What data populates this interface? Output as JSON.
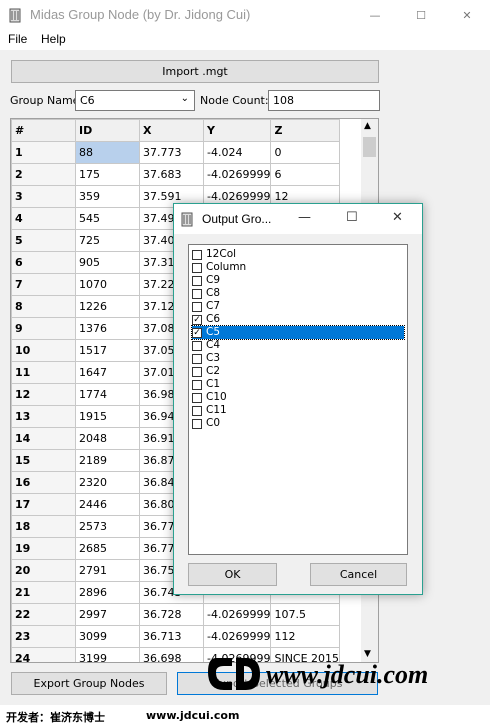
{
  "window": {
    "title": "Midas Group Node (by Dr. Jidong Cui)",
    "minimize": "—",
    "maximize": "☐",
    "close": "✕"
  },
  "menu": {
    "file": "File",
    "help": "Help"
  },
  "toolbar": {
    "import_label": "Import .mgt"
  },
  "group": {
    "label": "Group Name",
    "value": "C6",
    "node_count_label": "Node Count:",
    "node_count_value": "108"
  },
  "table": {
    "headers": [
      "#",
      "ID",
      "X",
      "Y",
      "Z"
    ],
    "rows": [
      [
        "1",
        "88",
        "37.773",
        "-4.024",
        "0"
      ],
      [
        "2",
        "175",
        "37.683",
        "-4.0269999",
        "6"
      ],
      [
        "3",
        "359",
        "37.591",
        "-4.0269999",
        "12"
      ],
      [
        "4",
        "545",
        "37.499",
        "",
        ""
      ],
      [
        "5",
        "725",
        "37.407",
        "",
        ""
      ],
      [
        "6",
        "905",
        "37.315",
        "",
        ""
      ],
      [
        "7",
        "1070",
        "37.223",
        "",
        ""
      ],
      [
        "8",
        "1226",
        "37.121",
        "",
        ""
      ],
      [
        "9",
        "1376",
        "37.088",
        "",
        ""
      ],
      [
        "10",
        "1517",
        "37.053",
        "",
        ""
      ],
      [
        "11",
        "1647",
        "37.018",
        "",
        ""
      ],
      [
        "12",
        "1774",
        "36.983",
        "",
        ""
      ],
      [
        "13",
        "1915",
        "36.948",
        "",
        ""
      ],
      [
        "14",
        "2048",
        "36.913",
        "",
        ""
      ],
      [
        "15",
        "2189",
        "36.878",
        "",
        ""
      ],
      [
        "16",
        "2320",
        "36.843",
        "",
        ""
      ],
      [
        "17",
        "2446",
        "36.808",
        "",
        ""
      ],
      [
        "18",
        "2573",
        "36.773",
        "",
        ""
      ],
      [
        "19",
        "2685",
        "36.773",
        "",
        ""
      ],
      [
        "20",
        "2791",
        "36.758",
        "",
        ""
      ],
      [
        "21",
        "2896",
        "36.743",
        "",
        ""
      ],
      [
        "22",
        "2997",
        "36.728",
        "-4.0269999",
        "107.5"
      ],
      [
        "23",
        "3099",
        "36.713",
        "-4.0269999",
        "112"
      ],
      [
        "24",
        "3199",
        "36.698",
        "-4.0269999",
        "SINCE 2015"
      ]
    ]
  },
  "dialog": {
    "title": "Output Gro...",
    "items": [
      {
        "label": "12Col",
        "checked": false
      },
      {
        "label": "Column",
        "checked": false
      },
      {
        "label": "C9",
        "checked": false
      },
      {
        "label": "C8",
        "checked": false
      },
      {
        "label": "C7",
        "checked": false
      },
      {
        "label": "C6",
        "checked": true
      },
      {
        "label": "C5",
        "checked": true
      },
      {
        "label": "C4",
        "checked": false
      },
      {
        "label": "C3",
        "checked": false
      },
      {
        "label": "C2",
        "checked": false
      },
      {
        "label": "C1",
        "checked": false
      },
      {
        "label": "C10",
        "checked": false
      },
      {
        "label": "C11",
        "checked": false
      },
      {
        "label": "C0",
        "checked": false
      }
    ],
    "ok": "OK",
    "cancel": "Cancel"
  },
  "bottom": {
    "export_label": "Export Group Nodes",
    "second_label": "Export Selected Groups"
  },
  "footer": {
    "developer": "开发者：崔济东博士",
    "url": "www.jdcui.com",
    "logo_url": "www.jdcui.com"
  }
}
